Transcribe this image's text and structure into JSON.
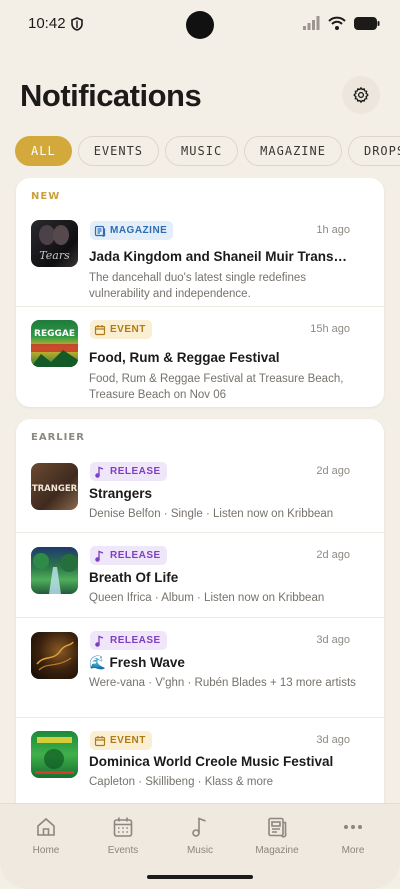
{
  "status_bar": {
    "time": "10:42"
  },
  "header": {
    "title": "Notifications"
  },
  "chips": [
    {
      "label": "ALL",
      "active": true
    },
    {
      "label": "EVENTS",
      "active": false
    },
    {
      "label": "MUSIC",
      "active": false
    },
    {
      "label": "MAGAZINE",
      "active": false
    },
    {
      "label": "DROPS",
      "active": false
    }
  ],
  "sections": {
    "new": {
      "label": "NEW",
      "items": [
        {
          "type": "MAGAZINE",
          "time": "1h ago",
          "title": "Jada Kingdom and Shaneil Muir Transfor…",
          "desc": "The dancehall duo's latest single redefines vulnerability and independence.",
          "thumb_text": "Tears"
        },
        {
          "type": "EVENT",
          "time": "15h ago",
          "title": "Food, Rum & Reggae Festival",
          "desc": "Food, Rum & Reggae Festival at Treasure Beach, Treasure Beach on Nov 06",
          "thumb_text": "REGGAE"
        }
      ]
    },
    "earlier": {
      "label": "EARLIER",
      "items": [
        {
          "type": "RELEASE",
          "time": "2d ago",
          "title": "Strangers",
          "desc": "Denise Belfon · Single · Listen now on Kribbean",
          "thumb_text": "STRANGERS"
        },
        {
          "type": "RELEASE",
          "time": "2d ago",
          "title": "Breath Of Life",
          "desc": "Queen Ifrica · Album · Listen now on Kribbean"
        },
        {
          "type": "RELEASE",
          "time": "3d ago",
          "title": "🌊 Fresh Wave",
          "desc": "Were-vana · V'ghn · Rubén Blades + 13 more artists"
        },
        {
          "type": "EVENT",
          "time": "3d ago",
          "title": "Dominica World Creole Music Festival",
          "desc": "Capleton · Skillibeng · Klass & more"
        }
      ]
    }
  },
  "bottom_nav": [
    {
      "label": "Home",
      "icon": "home-icon"
    },
    {
      "label": "Events",
      "icon": "calendar-icon"
    },
    {
      "label": "Music",
      "icon": "music-note-icon"
    },
    {
      "label": "Magazine",
      "icon": "newspaper-icon"
    },
    {
      "label": "More",
      "icon": "more-dots-icon"
    }
  ],
  "colors": {
    "background": "#f4efe6",
    "accent": "#d2a93a",
    "magazine_badge": "#2e6db4",
    "event_badge": "#b07a14",
    "release_badge": "#7e3fc4"
  }
}
